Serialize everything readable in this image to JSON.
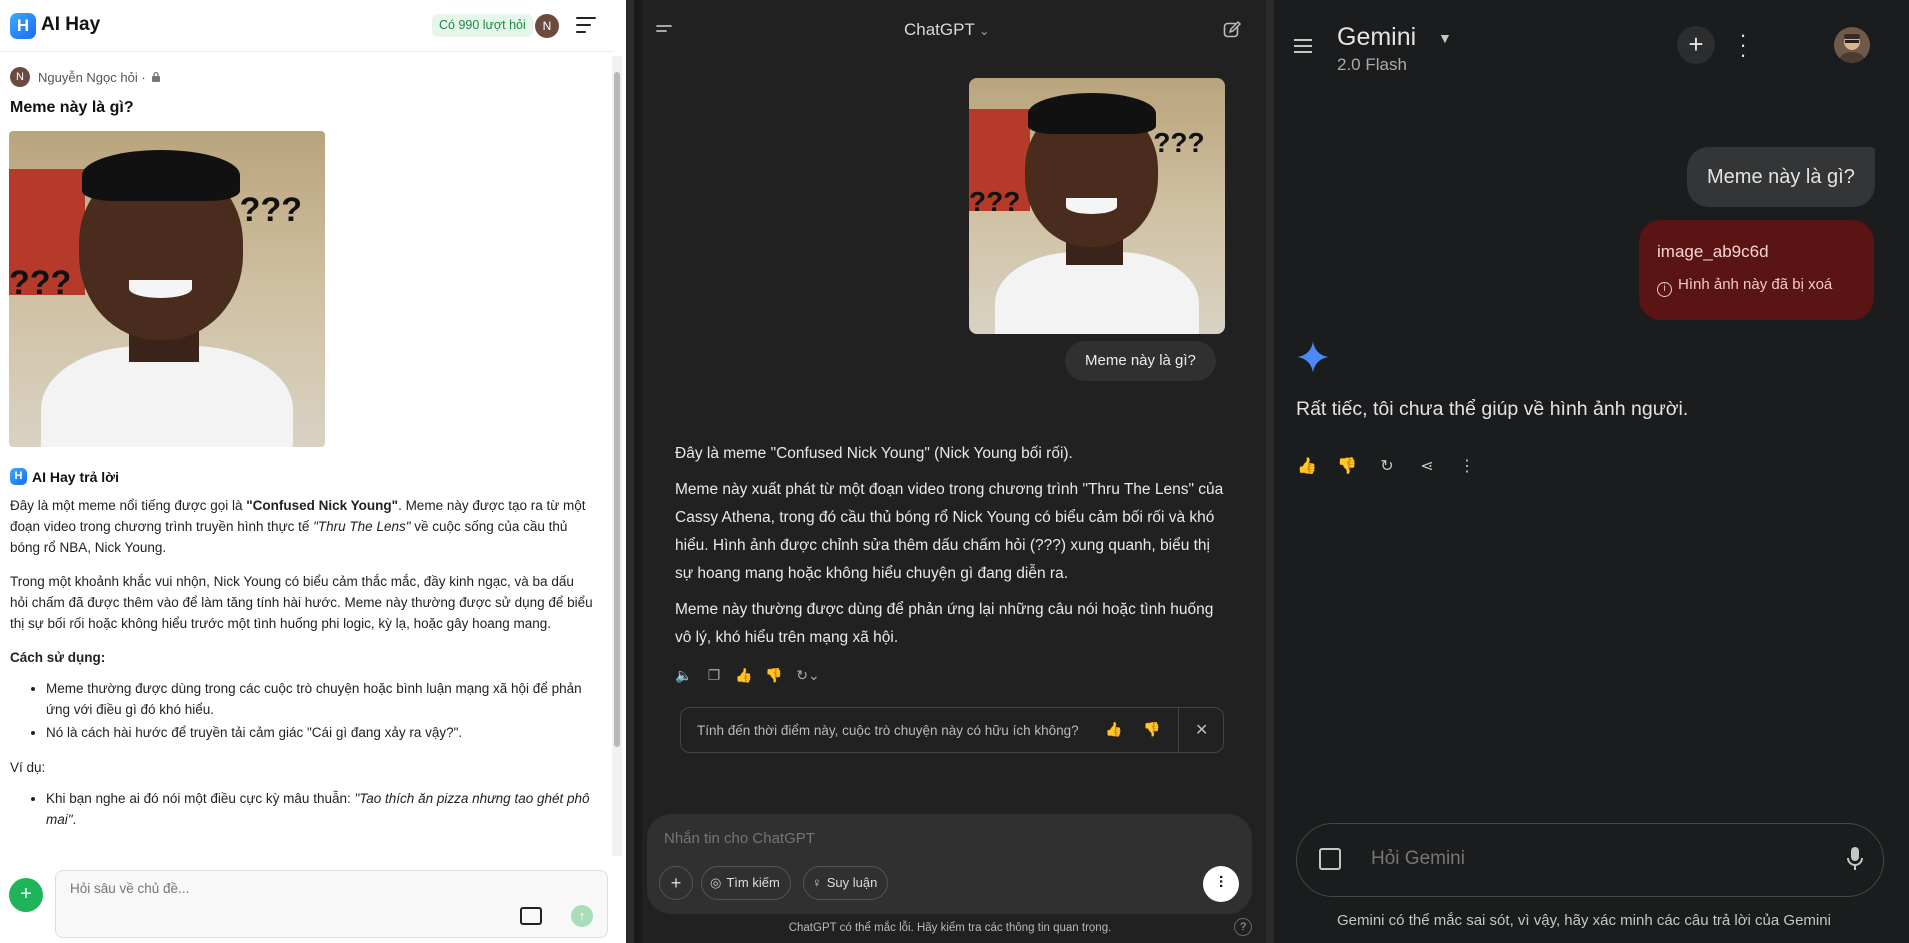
{
  "aihay": {
    "brand": "AI Hay",
    "logo_letter": "H",
    "quota": "Có 990 lượt hỏi",
    "avatar_letter": "N",
    "asker": "Nguyễn Ngọc hỏi ·",
    "question": "Meme này là gì?",
    "answer_label": "AI Hay trả lời",
    "p1_before": "Đây là một meme nổi tiếng được gọi là ",
    "p1_bold": "\"Confused Nick Young\"",
    "p1_mid": ". Meme này được tạo ra từ một đoạn video trong chương trình truyền hình thực tế ",
    "p1_italic": "\"Thru The Lens\"",
    "p1_after": " về cuộc sống của cầu thủ bóng rổ NBA, Nick Young.",
    "p2": "Trong một khoảnh khắc vui nhộn, Nick Young có biểu cảm thắc mắc, đầy kinh ngạc, và ba dấu hỏi chấm đã được thêm vào để làm tăng tính hài hước. Meme này thường được sử dụng để biểu thị sự bối rối hoặc không hiểu trước một tình huống phi logic, kỳ lạ, hoặc gây hoang mang.",
    "usage_heading": "Cách sử dụng:",
    "usage_items": [
      "Meme thường được dùng trong các cuộc trò chuyện hoặc bình luận mạng xã hội để phản ứng với điều gì đó khó hiểu.",
      "Nó là cách hài hước để truyền tải cảm giác \"Cái gì đang xảy ra vậy?\"."
    ],
    "example_heading": "Ví dụ:",
    "example_before": "Khi bạn nghe ai đó nói một điều cực kỳ mâu thuẫn: ",
    "example_italic": "\"Tao thích ăn pizza nhưng tao ghét phô mai\"",
    "example_after": ".",
    "input_placeholder": "Hỏi sâu về chủ đề...",
    "meme_marks": "???"
  },
  "chatgpt": {
    "title": "ChatGPT",
    "user_message": "Meme này là gì?",
    "reply_p1": "Đây là meme \"Confused Nick Young\" (Nick Young bối rối).",
    "reply_p2": "Meme này xuất phát từ một đoạn video trong chương trình \"Thru The Lens\" của Cassy Athena, trong đó cầu thủ bóng rổ Nick Young có biểu cảm bối rối và khó hiểu. Hình ảnh được chỉnh sửa thêm dấu chấm hỏi (???) xung quanh, biểu thị sự hoang mang hoặc không hiểu chuyện gì đang diễn ra.",
    "reply_p3": "Meme này thường được dùng để phản ứng lại những câu nói hoặc tình huống vô lý, khó hiểu trên mạng xã hội.",
    "feedback_question": "Tính đến thời điểm này, cuộc trò chuyện này có hữu ích không?",
    "input_placeholder": "Nhắn tin cho ChatGPT",
    "search_label": "Tìm kiếm",
    "reason_label": "Suy luận",
    "disclaimer": "ChatGPT có thể mắc lỗi. Hãy kiểm tra các thông tin quan trọng.",
    "help_label": "?"
  },
  "gemini": {
    "title": "Gemini",
    "model": "2.0 Flash",
    "user_message": "Meme này là gì?",
    "image_name": "image_ab9c6d",
    "image_status": "Hình ảnh này đã bị xoá",
    "reply": "Rất tiếc, tôi chưa thể giúp về hình ảnh người.",
    "input_placeholder": "Hỏi Gemini",
    "disclaimer": "Gemini có thể mắc sai sót, vì vậy, hãy xác minh các câu trả lời của Gemini"
  },
  "colors": {
    "aihay_green": "#1fb45a",
    "chatgpt_bg": "#212121",
    "gemini_bg": "#1b1c1d",
    "gemini_error_card": "#5a1414",
    "gemini_spark": "#4a8af4"
  }
}
